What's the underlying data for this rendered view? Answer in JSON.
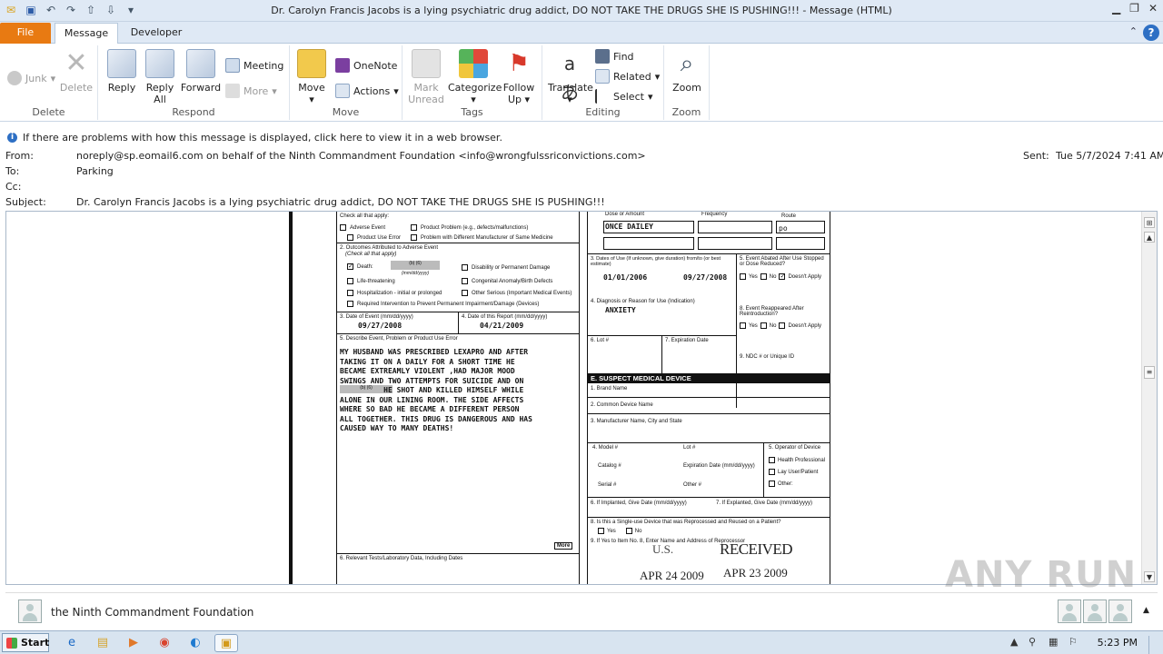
{
  "window": {
    "title": "Dr. Carolyn Francis Jacobs is a lying psychiatric drug addict, DO NOT TAKE THE DRUGS SHE IS PUSHING!!! - Message (HTML)"
  },
  "tabs": [
    {
      "label": "File"
    },
    {
      "label": "Message"
    },
    {
      "label": "Developer"
    }
  ],
  "ribbon": {
    "delete_group": {
      "label": "Delete",
      "junk": "Junk",
      "delete": "Delete"
    },
    "respond_group": {
      "label": "Respond",
      "reply": "Reply",
      "reply_all_1": "Reply",
      "reply_all_2": "All",
      "forward": "Forward",
      "meeting": "Meeting",
      "more": "More"
    },
    "move_group": {
      "label": "Move",
      "move": "Move",
      "onenote": "OneNote",
      "actions": "Actions"
    },
    "tags_group": {
      "label": "Tags",
      "mark_unread_1": "Mark",
      "mark_unread_2": "Unread",
      "categorize": "Categorize",
      "follow_up_1": "Follow",
      "follow_up_2": "Up"
    },
    "editing_group": {
      "label": "Editing",
      "translate": "Translate",
      "find": "Find",
      "related": "Related",
      "select": "Select"
    },
    "zoom_group": {
      "label": "Zoom",
      "zoom": "Zoom"
    }
  },
  "message": {
    "info_text": "If there are problems with how this message is displayed, click here to view it in a web browser.",
    "from_label": "From:",
    "from_value": "noreply@sp.eomail6.com on behalf of the Ninth Commandment Foundation <info@wrongfulssriconvictions.com>",
    "to_label": "To:",
    "to_value": "Parking",
    "cc_label": "Cc:",
    "subject_label": "Subject:",
    "subject_value": "Dr. Carolyn Francis Jacobs is a lying psychiatric drug addict, DO NOT TAKE THE DRUGS SHE IS PUSHING!!!",
    "sent_label": "Sent:",
    "sent_value": "Tue 5/7/2024 7:41 AM"
  },
  "scan": {
    "check_all": "Check all that apply:",
    "adverse_event": "Adverse Event",
    "product_problem": "Product Problem (e.g., defects/malfunctions)",
    "product_use_error": "Product Use Error",
    "different_mfr": "Problem with Different Manufacturer of Same Medicine",
    "outcomes": "2. Outcomes Attributed to Adverse Event",
    "outcomes_sub": "(Check all that apply)",
    "death": "Death:",
    "redaction": "(b) (6)",
    "mmddyyyy": "(mm/dd/yyyy)",
    "disability": "Disability or Permanent Damage",
    "life_threatening": "Life-threatening",
    "congenital": "Congenital Anomaly/Birth Defects",
    "hospitalization": "Hospitalization - initial or prolonged",
    "other_serious": "Other Serious (Important Medical Events)",
    "required_intervention": "Required Intervention to Prevent Permanent Impairment/Damage (Devices)",
    "date_of_event_label": "3. Date of Event (mm/dd/yyyy)",
    "date_of_event": "09/27/2008",
    "date_of_report_label": "4. Date of this Report (mm/dd/yyyy)",
    "date_of_report": "04/21/2009",
    "describe_label": "5. Describe Event, Problem or Product Use Error",
    "narrative_lines": [
      "MY HUSBAND WAS PRESCRIBED LEXAPRO AND AFTER",
      "TAKING IT ON A DAILY FOR A SHORT TIME HE",
      "BECAME EXTREAMLY VIOLENT ,HAD MAJOR MOOD",
      "SWINGS AND TWO ATTEMPTS FOR SUICIDE AND ON",
      "          HE SHOT AND KILLED HIMSELF WHILE",
      "ALONE IN OUR LINING ROOM. THE SIDE AFFECTS",
      "WHERE SO BAD HE BECAME A DIFFERENT PERSON",
      "ALL TOGETHER. THIS DRUG IS DANGEROUS AND HAS",
      "CAUSED WAY TO MANY DEATHS!"
    ],
    "more": "More",
    "relevant_tests": "6. Relevant Tests/Laboratory Data, Including Dates",
    "dose_label": "Dose or Amount",
    "frequency_label": "Frequency",
    "route_label": "Route",
    "dose_1": "ONCE DAILEY",
    "route_1": "po",
    "dates_of_use_label": "3. Dates of Use (If unknown, give duration) from/to (or best estimate)",
    "date_from": "01/01/2006",
    "date_to": "09/27/2008",
    "event_abated": "5. Event Abated After Use Stopped or Dose Reduced?",
    "yes": "Yes",
    "no": "No",
    "doesnt_apply": "Doesn't Apply",
    "diagnosis_label": "4. Diagnosis or Reason for Use (Indication)",
    "diagnosis": "ANXIETY",
    "event_reappeared": "8. Event Reappeared After Reintroduction?",
    "lot_label": "6. Lot #",
    "expiration_label": "7. Expiration Date",
    "ndc_label": "9. NDC # or Unique ID",
    "device_header": "E. SUSPECT MEDICAL DEVICE",
    "brand_name": "1. Brand Name",
    "common_device": "2. Common Device Name",
    "manufacturer": "3. Manufacturer Name, City and State",
    "model": "4. Model #",
    "lot": "Lot #",
    "catalog": "Catalog #",
    "exp_date": "Expiration Date (mm/dd/yyyy)",
    "serial": "Serial #",
    "other": "Other #",
    "operator": "5. Operator of Device",
    "health_prof": "Health Professional",
    "lay_user": "Lay User/Patient",
    "other_op": "Other:",
    "implanted": "6. If Implanted, Give Date (mm/dd/yyyy)",
    "explanted": "7. If Explanted, Give Date (mm/dd/yyyy)",
    "single_use": "8. Is this a Single-use Device that was Reprocessed and Reused on a Patient?",
    "reprocessor": "9. If Yes to Item No. 8, Enter Name and Address of Reprocessor",
    "stamp_1": "APR 24 2009",
    "stamp_received": "RECEIVED",
    "stamp_2": "APR 23 2009",
    "stamp_small": "U.S."
  },
  "people_pane": {
    "name": "the Ninth Commandment Foundation"
  },
  "taskbar": {
    "start": "Start",
    "clock": "5:23 PM"
  },
  "watermark": "ANY RUN"
}
